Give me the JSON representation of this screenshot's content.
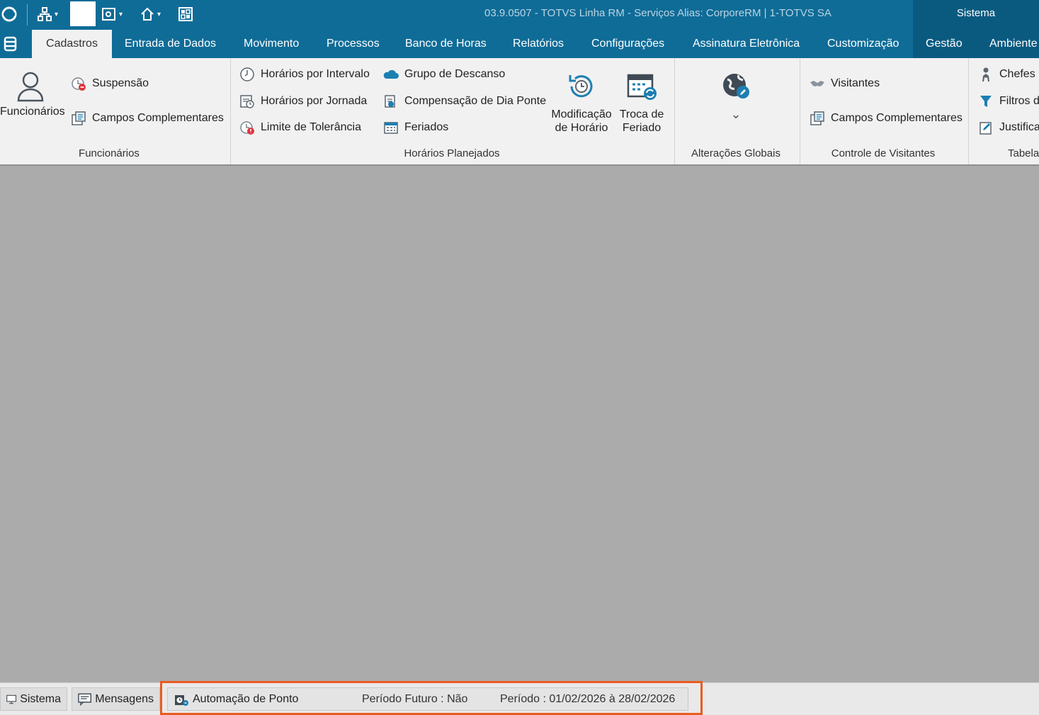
{
  "window": {
    "title": "03.9.0507 - TOTVS Linha RM - Serviços  Alias: CorporeRM | 1-TOTVS SA",
    "top_right_label": "Sistema"
  },
  "menu": {
    "tabs": [
      {
        "label": "Cadastros",
        "active": true
      },
      {
        "label": "Entrada de Dados"
      },
      {
        "label": "Movimento"
      },
      {
        "label": "Processos"
      },
      {
        "label": "Banco de Horas"
      },
      {
        "label": "Relatórios"
      },
      {
        "label": "Configurações"
      },
      {
        "label": "Assinatura Eletrônica"
      },
      {
        "label": "Customização"
      },
      {
        "label": "Gestão"
      },
      {
        "label": "Ambiente"
      }
    ]
  },
  "ribbon": {
    "funcionarios_group": {
      "label": "Funcionários",
      "big_button": "Funcionários",
      "items": [
        "Suspensão",
        "Campos Complementares"
      ]
    },
    "horarios_group": {
      "label": "Horários Planejados",
      "col1": [
        "Horários por Intervalo",
        "Horários por Jornada",
        "Limite de Tolerância"
      ],
      "col2": [
        "Grupo de Descanso",
        "Compensação de Dia Ponte",
        "Feriados"
      ],
      "big1_line1": "Modificação",
      "big1_line2": "de Horário",
      "big2_line1": "Troca de",
      "big2_line2": "Feriado"
    },
    "alteracoes_group": {
      "label": "Alterações Globais",
      "caret": "⌄"
    },
    "visitantes_group": {
      "label": "Controle de Visitantes",
      "items": [
        "Visitantes",
        "Campos Complementares"
      ]
    },
    "tabelas_group": {
      "label": "Tabela",
      "items": [
        "Chefes",
        "Filtros d",
        "Justifica"
      ]
    }
  },
  "statusbar": {
    "sistema": "Sistema",
    "mensagens": "Mensagens",
    "automacao": "Automação de Ponto",
    "periodo_futuro": "Período Futuro : Não",
    "periodo": "Período : 01/02/2026 à 28/02/2026"
  },
  "colors": {
    "titlebar": "#0f6c97",
    "highlight": "#ea5b1f",
    "workspace": "#ababab"
  }
}
